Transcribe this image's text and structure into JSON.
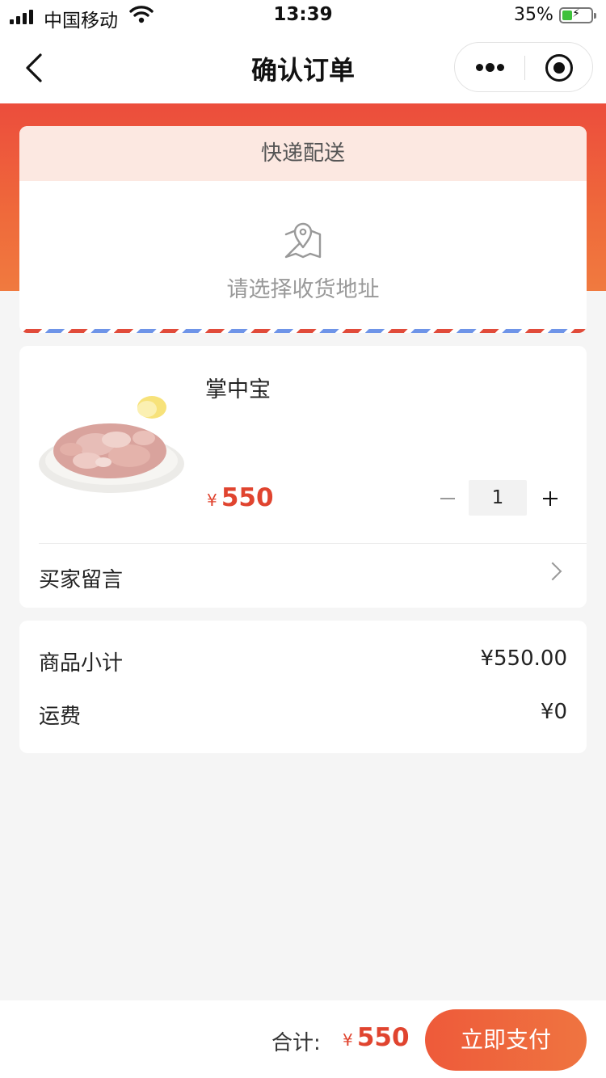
{
  "status_bar": {
    "carrier": "中国移动",
    "time": "13:39",
    "battery_percent": "35%",
    "battery_level": 0.35,
    "charging": true
  },
  "nav": {
    "title": "确认订单",
    "back_icon": "chevron-left-icon",
    "more_icon": "more-dots-icon",
    "close_icon": "target-circle-icon"
  },
  "address": {
    "tab_label": "快递配送",
    "placeholder": "请选择收货地址",
    "icon": "map-pin-icon"
  },
  "product": {
    "name": "掌中宝",
    "currency": "¥",
    "price": "550",
    "quantity": "1",
    "image": "food-plate-image"
  },
  "message": {
    "label": "买家留言",
    "icon": "chevron-right-icon"
  },
  "summary": {
    "subtotal_label": "商品小计",
    "subtotal_value": "¥550.00",
    "shipping_label": "运费",
    "shipping_value": "¥0"
  },
  "footer": {
    "total_label": "合计:",
    "currency": "¥",
    "total": "550",
    "pay_label": "立即支付"
  },
  "colors": {
    "accent": "#e0442f",
    "header_gradient_start": "#ec4d3c",
    "header_gradient_end": "#f07a3f",
    "delivery_tab_bg": "#fce8e1"
  }
}
